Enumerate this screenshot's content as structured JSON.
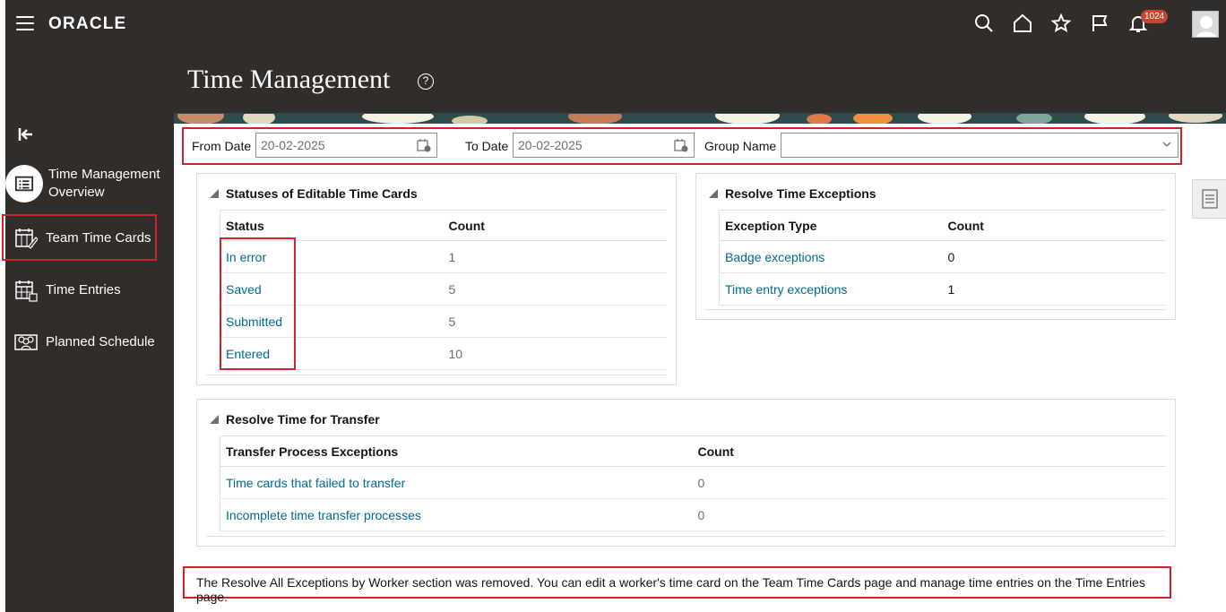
{
  "app": {
    "logo": "ORACLE",
    "notification_count": "1024",
    "page_title": "Time Management"
  },
  "topbar_icons": [
    "search-icon",
    "home-icon",
    "favorites-star-icon",
    "flag-icon",
    "bell-icon"
  ],
  "sidebar": {
    "items": [
      {
        "label": "Time Management Overview",
        "icon": "overview-list-icon"
      },
      {
        "label": "Team Time Cards",
        "icon": "team-calendar-edit-icon"
      },
      {
        "label": "Time Entries",
        "icon": "calendar-grid-icon"
      },
      {
        "label": "Planned Schedule",
        "icon": "team-people-icon"
      }
    ]
  },
  "filters": {
    "from_date_label": "From Date",
    "from_date_value": "20-02-2025",
    "to_date_label": "To Date",
    "to_date_value": "20-02-2025",
    "group_name_label": "Group Name",
    "group_name_value": ""
  },
  "statuses_panel": {
    "title": "Statuses of Editable Time Cards",
    "col_status": "Status",
    "col_count": "Count",
    "rows": [
      {
        "status": "In error",
        "count": "1"
      },
      {
        "status": "Saved",
        "count": "5"
      },
      {
        "status": "Submitted",
        "count": "5"
      },
      {
        "status": "Entered",
        "count": "10"
      }
    ]
  },
  "exceptions_panel": {
    "title": "Resolve Time Exceptions",
    "col_type": "Exception Type",
    "col_count": "Count",
    "rows": [
      {
        "type": "Badge exceptions",
        "count": "0"
      },
      {
        "type": "Time entry exceptions",
        "count": "1"
      }
    ]
  },
  "transfer_panel": {
    "title": "Resolve Time for Transfer",
    "col_exceptions": "Transfer Process Exceptions",
    "col_count": "Count",
    "rows": [
      {
        "label": "Time cards that failed to transfer",
        "count": "0"
      },
      {
        "label": "Incomplete time transfer processes",
        "count": "0"
      }
    ]
  },
  "note": "The Resolve All Exceptions by Worker section was removed. You can edit a worker's time card on the Team Time Cards page and manage time entries on the Time Entries page.",
  "colors": {
    "header_bg": "#312d2a",
    "link": "#006b8f",
    "highlight_red": "#d0202a",
    "badge": "#c74634"
  }
}
